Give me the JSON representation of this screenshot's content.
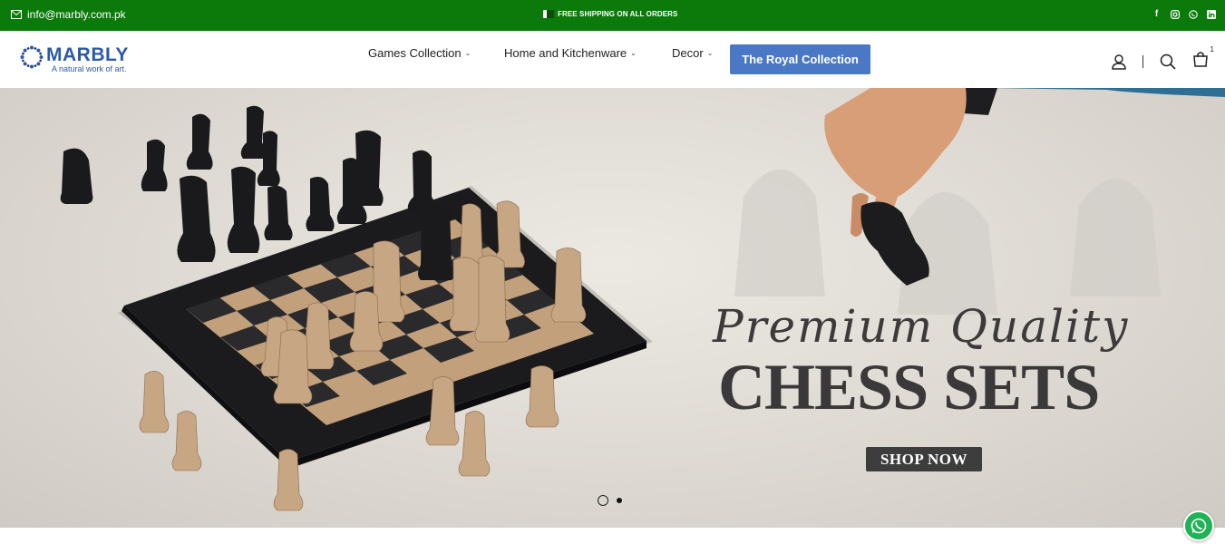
{
  "topbar": {
    "email": "info@marbly.com.pk",
    "promo": "FREE SHIPPING ON ALL ORDERS",
    "social_icons": [
      "facebook-icon",
      "instagram-icon",
      "whatsapp-icon",
      "linkedin-icon"
    ],
    "background": "#0b7a0b"
  },
  "header": {
    "logo": {
      "name": "MARBLY",
      "tagline": "A natural work of art."
    },
    "nav": [
      {
        "label": "Games Collection"
      },
      {
        "label": "Home and Kitchenware"
      },
      {
        "label": "Decor"
      }
    ],
    "cta_label": "The Royal Collection",
    "cta_color": "#4a78c4",
    "cart_count": "1",
    "icons": [
      "account-icon",
      "search-icon",
      "cart-icon"
    ]
  },
  "hero": {
    "script_text": "Premium Quality",
    "headline": "CHESS SETS",
    "button_label": "SHOP NOW",
    "slides": 2,
    "active_slide": 1
  }
}
